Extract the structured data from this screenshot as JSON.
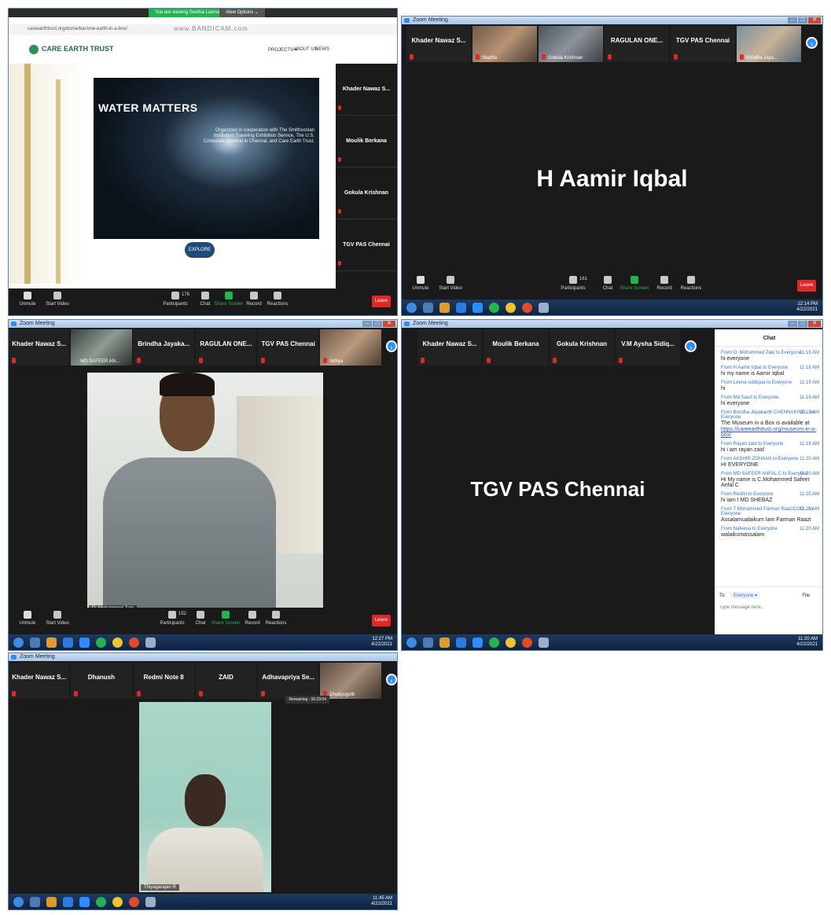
{
  "panel1": {
    "zoom_banner": "You are viewing Seetha Laxman",
    "view_options": "View Options ⌄",
    "url": "careearthtrust.org/dome/bar/one-earth-in-a-box/",
    "watermark": "www.BANDICAM.com",
    "site_logo": "CARE EARTH TRUST",
    "nav": [
      "PROJECTS ▾",
      "ABOUT US",
      "NEWS"
    ],
    "hero_title": "WATER MATTERS",
    "hero_org": "Organized in cooperation with The Smithsonian Institution Traveling Exhibition Service, The U.S. Consulate General in Chennai, and Care Earth Trust.",
    "explore": "EXPLORE",
    "side_participants": [
      "Khader Nawaz S...",
      "Moulik Berkana",
      "Gokula Krishnan",
      "TGV PAS Chennai"
    ],
    "toolbar": {
      "unmute": "Unmute",
      "start_video": "Start Video",
      "participants": "Participants",
      "participants_count": "176",
      "chat": "Chat",
      "share": "Share Screen",
      "record": "Record",
      "reactions": "Reactions",
      "leave": "Leave"
    }
  },
  "panel2": {
    "title": "Zoom Meeting",
    "strip": [
      {
        "label": "Khader Nawaz S...",
        "video": false
      },
      {
        "label": "Seetha",
        "video": true
      },
      {
        "label": "Gokula Krishnan",
        "video": true
      },
      {
        "label": "RAGULAN ONE...",
        "video": false
      },
      {
        "label": "TGV PAS Chennai",
        "video": false
      },
      {
        "label": "Brindha Jaya...",
        "video": true
      }
    ],
    "speaker": "H Aamir Iqbal",
    "toolbar": {
      "unmute": "Unmute",
      "start_video": "Start Video",
      "participants": "Participants",
      "participants_count": "161",
      "chat": "Chat",
      "share": "Share Screen",
      "record": "Record",
      "reactions": "Reactions",
      "leave": "Leave"
    },
    "time": "12:14 PM",
    "date": "4/22/2021"
  },
  "panel3": {
    "title": "Zoom Meeting",
    "strip": [
      {
        "label": "Khader Nawaz S...",
        "video": false
      },
      {
        "label": "MD SAFEER AN...",
        "video": true
      },
      {
        "label": "Brindha Jayaka...",
        "video": false
      },
      {
        "label": "RAGULAN ONE...",
        "video": false
      },
      {
        "label": "TGV PAS Chennai",
        "video": false
      },
      {
        "label": "Nithya",
        "video": true
      }
    ],
    "speaker_badge": "O. Mohammed Zaki",
    "toolbar": {
      "unmute": "Unmute",
      "start_video": "Start Video",
      "participants": "Participants",
      "participants_count": "152",
      "chat": "Chat",
      "share": "Share Screen",
      "record": "Record",
      "reactions": "Reactions",
      "leave": "Leave"
    },
    "time": "12:27 PM",
    "date": "4/22/2021"
  },
  "panel4": {
    "title": "Zoom Meeting",
    "strip": [
      {
        "label": "Khader Nawaz S...",
        "video": false
      },
      {
        "label": "Moulik Berkana",
        "video": false
      },
      {
        "label": "Gokula Krishnan",
        "video": false
      },
      {
        "label": "V.M Aysha Sidiq...",
        "video": false
      }
    ],
    "speaker": "TGV PAS Chennai",
    "chat_title": "Chat",
    "messages": [
      {
        "from": "From O. Mohammed Zaki to Everyone",
        "time": "11:18 AM",
        "text": "hi everyone",
        "link": false
      },
      {
        "from": "From H Aamir Iqbal to Everyone",
        "time": "11:18 AM",
        "text": "hi my name is Aamir Iqbal",
        "link": false
      },
      {
        "from": "From Leena siddiqua to Everyone",
        "time": "11:19 AM",
        "text": "hi",
        "link": false
      },
      {
        "from": "From Md Saud to Everyone",
        "time": "11:19 AM",
        "text": "hi everyone",
        "link": false
      },
      {
        "from": "From Brindha Jayakanth CHENNAIUND... to Everyone",
        "time": "11:19 AM",
        "text": "The Museum in a Box is available at",
        "link": false
      },
      {
        "from": "",
        "time": "",
        "text": "https://careearthtrust.org/museum-in-a-box/",
        "link": true
      },
      {
        "from": "From Rayan zaid to Everyone",
        "time": "11:19 AM",
        "text": "hi i am rayan zaid",
        "link": false
      },
      {
        "from": "From AASHIR ZOHAAN to Everyone",
        "time": "11:20 AM",
        "text": "HI EVERYONE",
        "link": false
      },
      {
        "from": "From MD SAFEER ANFAL.C to Everyone",
        "time": "11:20 AM",
        "text": "Hi My name is C.Mohammed Safeer Anfal.C",
        "link": false
      },
      {
        "from": "From Redmi to Everyone",
        "time": "11:20 AM",
        "text": "hi iam I MD SHEBAZ",
        "link": false
      },
      {
        "from": "From T Mohammed Farman RaaziCOD... to Everyone",
        "time": "11:20 AM",
        "text": "Assalamualaikum Iam Farman Raazi",
        "link": false
      },
      {
        "from": "From Nafeesa to Everyone",
        "time": "11:20 AM",
        "text": "walaikumassalam",
        "link": false
      }
    ],
    "to_label": "To:",
    "to_value": "Everyone ▾",
    "file_label": "File",
    "input_placeholder": "Type message here...",
    "time": "11:20 AM",
    "date": "4/22/2021"
  },
  "panel5": {
    "title": "Zoom Meeting",
    "strip": [
      {
        "label": "Khader Nawaz S...",
        "video": false
      },
      {
        "label": "Dhanush",
        "video": false
      },
      {
        "label": "Redmi Note 8",
        "video": false
      },
      {
        "label": "ZAID",
        "video": false
      },
      {
        "label": "Adhavapriya Se...",
        "video": false
      },
      {
        "label": "Dhatipugelb",
        "video": true
      }
    ],
    "remaining": "Remaining : 00:23:04",
    "speaker_badge": "Thiyagarajan R",
    "time": "11:45 AM",
    "date": "4/22/2021"
  },
  "colors": {
    "zoom_blue": "#2d8cff",
    "leave_red": "#e02828",
    "share_green": "#24b350"
  }
}
